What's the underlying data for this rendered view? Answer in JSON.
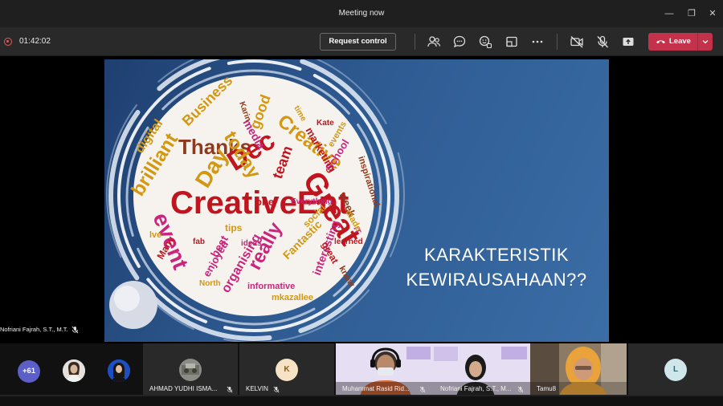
{
  "window": {
    "title": "Meeting now",
    "controls": {
      "minimize": "—",
      "restore": "❐",
      "close": "✕"
    }
  },
  "toolbar": {
    "timer": "01:42:02",
    "request_control_label": "Request control",
    "leave_label": "Leave",
    "icons": [
      "people-icon",
      "chat-icon",
      "reactions-icon",
      "rooms-icon",
      "more-icon",
      "camera-off-icon",
      "mic-off-icon",
      "share-icon"
    ]
  },
  "slide": {
    "title_line1": "KARAKTERISTIK",
    "title_line2": "KEWIRAUSAHAAN??",
    "words": [
      "CreativeEnt",
      "Great",
      "Thanks",
      "Dec",
      "event",
      "brilliant",
      "Day",
      "today",
      "Creative",
      "team",
      "School",
      "digital",
      "Business",
      "media",
      "good",
      "marketing",
      "events",
      "inspirational",
      "organising",
      "really",
      "Fantastic",
      "informative",
      "interesting",
      "tips",
      "best",
      "North",
      "mkazallee",
      "Kate",
      "learned",
      "know",
      "enjoyed",
      "week",
      "time",
      "Everything",
      "Karin",
      "lve",
      "ideas",
      "one",
      "IT",
      "Many",
      "social",
      "fab",
      "made",
      "great"
    ]
  },
  "presenter": {
    "name": "Nofriani Fajrah, S.T., M.T."
  },
  "participants": {
    "overflow_count": "+61",
    "tiles": [
      {
        "name": "AHMAD YUDHI ISMA..."
      },
      {
        "name": "KELVIN",
        "initial": "K"
      },
      {
        "name": "Muhammat Rasid Rid..."
      },
      {
        "name": "Nofriani Fajrah, S.T., M..."
      },
      {
        "name": "Tamu8"
      },
      {
        "initial": "L"
      }
    ]
  },
  "colors": {
    "leave": "#c4314b",
    "accent": "#5b5fc7",
    "kelvin_avatar": "#f6e2c4",
    "l_avatar": "#cfe7ea"
  }
}
